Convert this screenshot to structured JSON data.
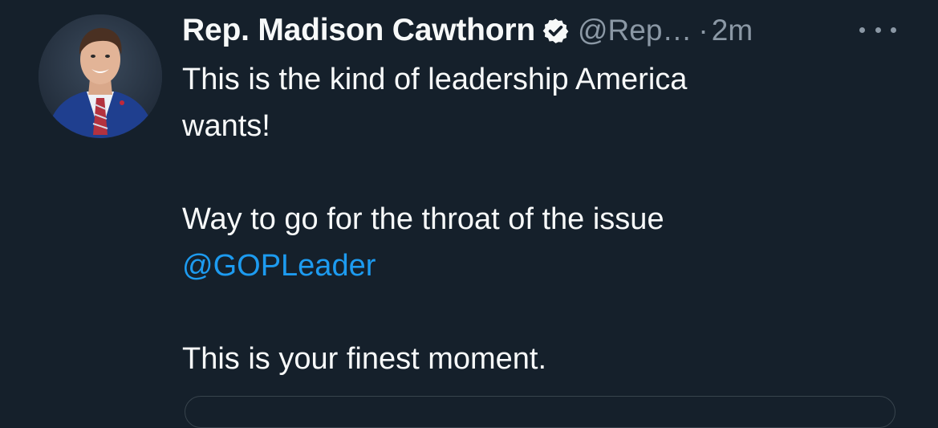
{
  "tweet": {
    "display_name": "Rep. Madison Cawthorn",
    "handle": "@Rep…",
    "separator": "·",
    "time": "2m",
    "text_line_1": "This is the kind of leadership America",
    "text_line_2": "wants!",
    "text_line_3": "Way to go for the throat of the issue",
    "mention": "@GOPLeader",
    "text_line_5": "This is your finest moment."
  },
  "icons": {
    "verified": "verified-badge-icon",
    "more": "more-options-icon"
  },
  "colors": {
    "background": "#15202b",
    "primary_text": "#f7f9f9",
    "secondary_text": "#8b98a5",
    "link": "#1d9bf0",
    "border": "#38444d"
  }
}
